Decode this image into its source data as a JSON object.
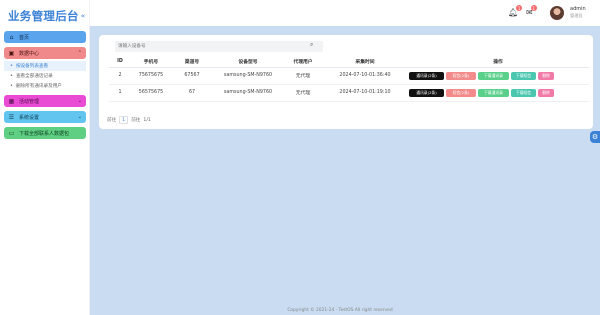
{
  "brand": {
    "title": "业务管理后台",
    "toggle": "«"
  },
  "menu": {
    "home": {
      "label": "首页",
      "icon": "home-icon"
    },
    "data": {
      "label": "数据中心",
      "icon": "database-icon",
      "chevron": "⌃"
    },
    "sub_items": [
      {
        "label": "按设备列表查看",
        "active": true
      },
      {
        "label": "查看全部通话记录",
        "active": false
      },
      {
        "label": "删除所有通讯录及用户",
        "active": false
      }
    ],
    "activity": {
      "label": "活动管理",
      "chevron": "⌄"
    },
    "system": {
      "label": "系统设置",
      "chevron": "⌄"
    },
    "download": {
      "label": "下载全部联系人数据包"
    }
  },
  "header": {
    "bell_badge": "1",
    "msg_badge": "1",
    "user_name": "admin",
    "user_role": "管理员"
  },
  "search": {
    "placeholder": "请输入设备号",
    "icon": "search-icon"
  },
  "table": {
    "headers": [
      "ID",
      "手机号",
      "渠道号",
      "设备型号",
      "代理用户",
      "采集时间",
      "操作"
    ],
    "rows": [
      {
        "id": "2",
        "phone": "75675675",
        "channel": "67567",
        "model": "samsung-SM-N9760",
        "agent": "无代理",
        "time": "2024-07-10-01:36:40"
      },
      {
        "id": "1",
        "phone": "56575675",
        "channel": "67",
        "model": "samsung-SM-N9760",
        "agent": "无代理",
        "time": "2024-07-10-01:19:10"
      }
    ],
    "actions": {
      "contacts": [
        "通讯录(2条)",
        "通讯录(2条)"
      ],
      "sms": "短信(2条)",
      "call_log": "下载通讯录",
      "download_sms": "下载短信",
      "delete": "删除"
    }
  },
  "pager": {
    "prev": "前往",
    "page": "1",
    "next": "前往",
    "total": "1/1"
  },
  "footer": "Copyright © 2021-24 · TestOS All right reserved",
  "colors": {
    "accent": "#3b82d6",
    "main_bg": "#c9dcf2"
  }
}
